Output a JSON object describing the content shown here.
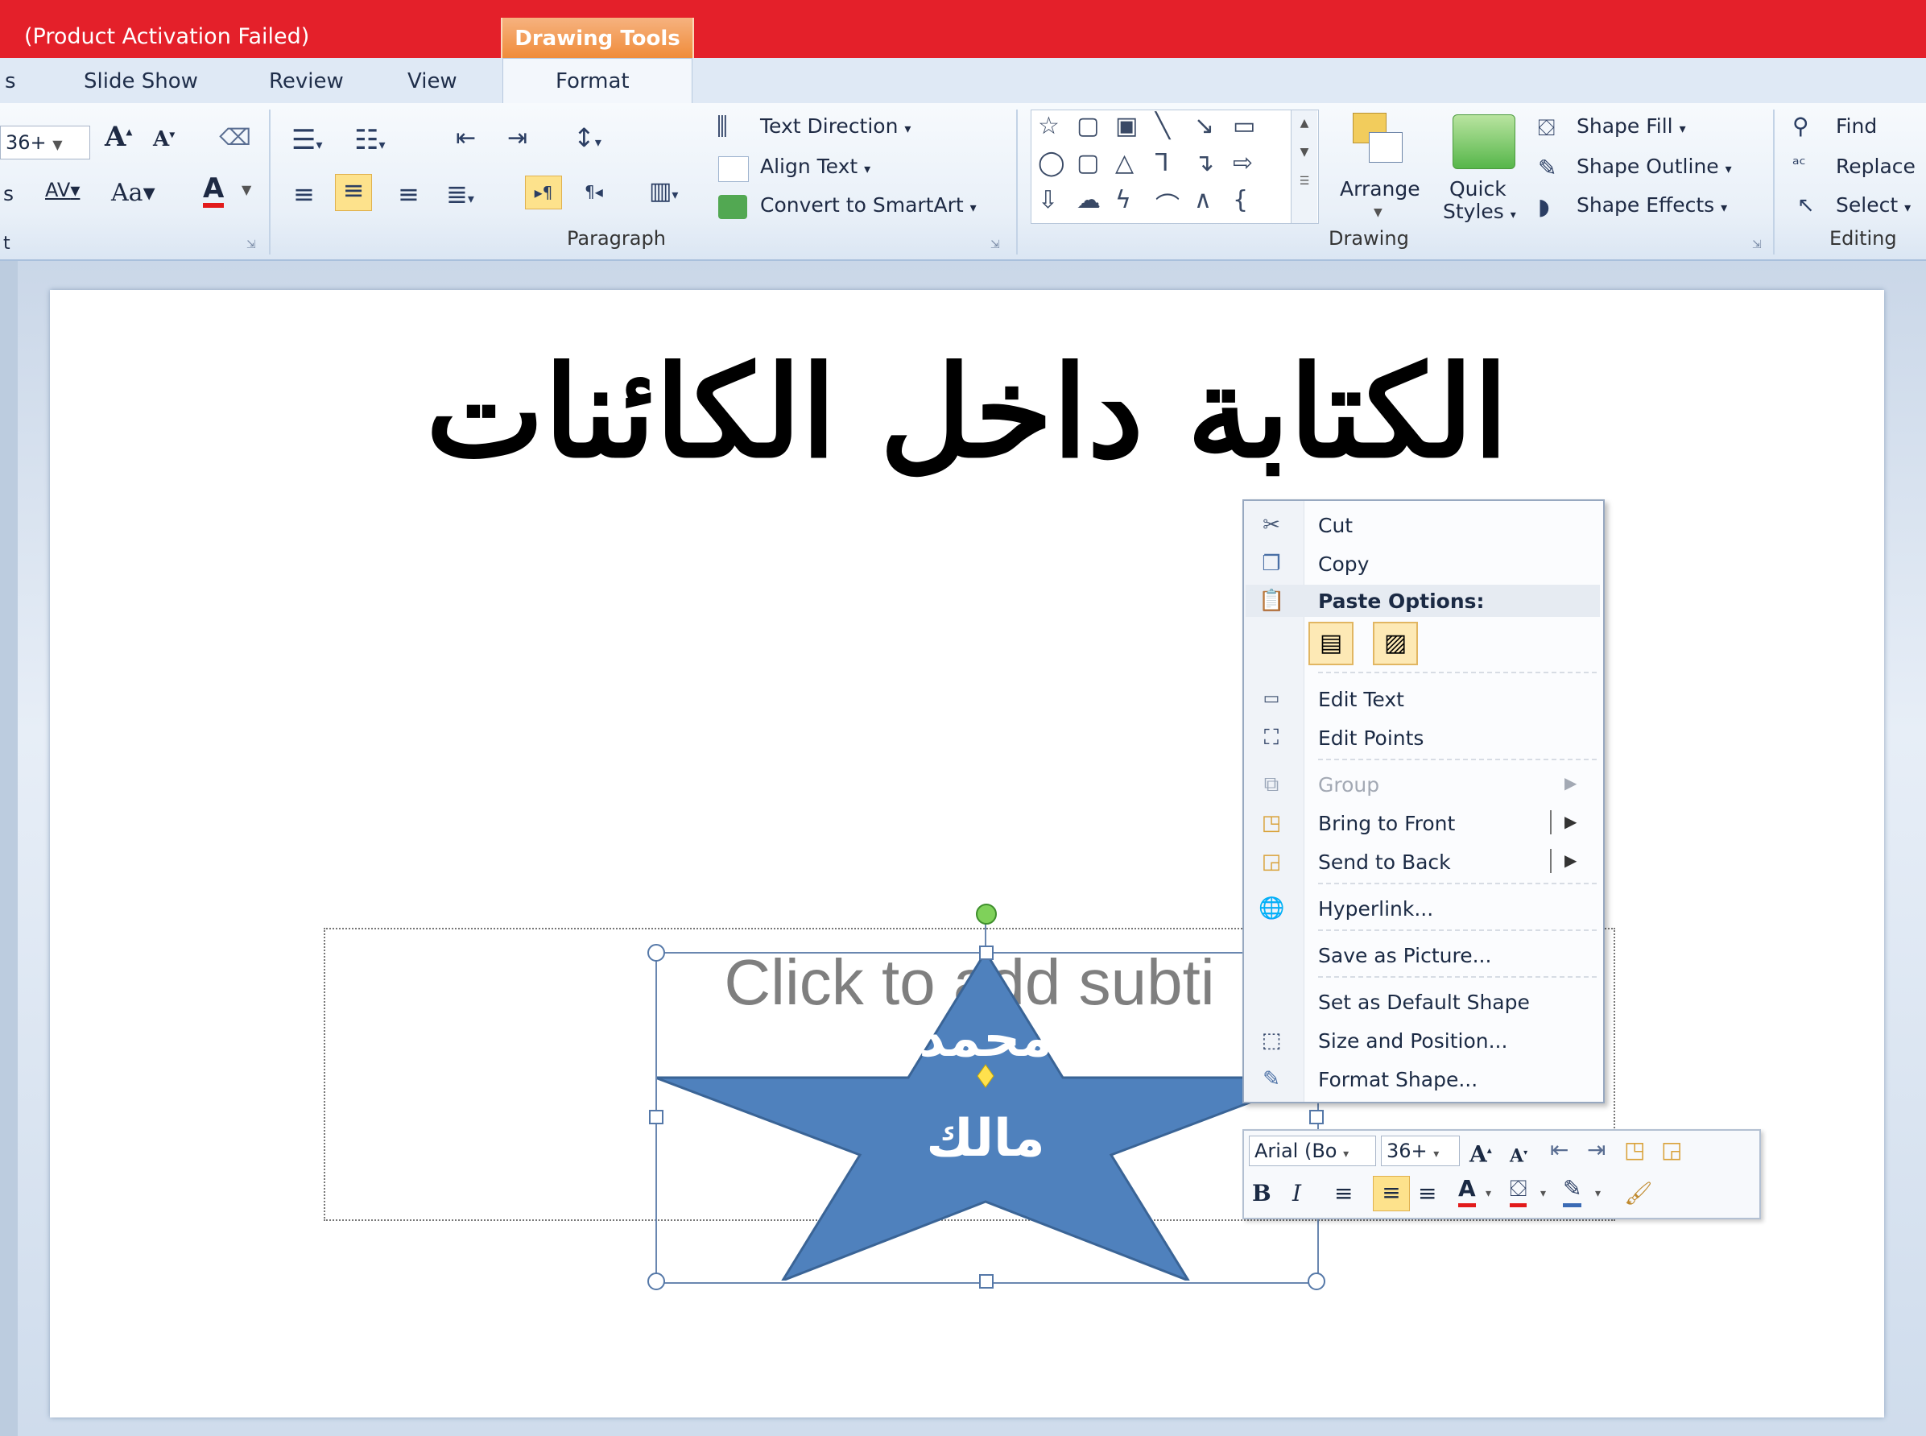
{
  "window": {
    "title": "(Product Activation Failed)",
    "contextual_tab": "Drawing Tools"
  },
  "tabs": {
    "partial_left": "s",
    "slide_show": "Slide Show",
    "review": "Review",
    "view": "View",
    "format": "Format"
  },
  "ribbon": {
    "font_group": {
      "font_size": "36+",
      "grow_font": "A",
      "shrink_font": "A",
      "change_case": "Aa",
      "char_spacing": "AV",
      "font_color": "A",
      "partial_label": "t",
      "partial_left": "s"
    },
    "paragraph_group": {
      "label": "Paragraph",
      "text_direction": "Text Direction",
      "align_text": "Align Text",
      "convert_smartart": "Convert to SmartArt"
    },
    "drawing_group": {
      "label": "Drawing",
      "arrange": "Arrange",
      "quick_styles_line1": "Quick",
      "quick_styles_line2": "Styles",
      "shape_fill": "Shape Fill",
      "shape_outline": "Shape Outline",
      "shape_effects": "Shape Effects"
    },
    "editing_group": {
      "label": "Editing",
      "find": "Find",
      "replace": "Replace",
      "select": "Select"
    }
  },
  "slide": {
    "title": "الكتابة داخل الكائنات",
    "subtitle_placeholder": "Click to add subti",
    "star_line1": "محمد",
    "star_line2": "مالك"
  },
  "context_menu": {
    "cut": "Cut",
    "copy": "Copy",
    "paste_options": "Paste Options:",
    "edit_text": "Edit Text",
    "edit_points": "Edit Points",
    "group": "Group",
    "bring_to_front": "Bring to Front",
    "send_to_back": "Send to Back",
    "hyperlink": "Hyperlink...",
    "save_as_picture": "Save as Picture...",
    "set_default_shape": "Set as Default Shape",
    "size_position": "Size and Position...",
    "format_shape": "Format Shape..."
  },
  "mini_toolbar": {
    "font": "Arial (Bo",
    "size": "36+",
    "bold": "B",
    "italic": "I",
    "font_color": "A"
  },
  "colors": {
    "title_bar": "#e4202a",
    "star_fill": "#4f81bd",
    "contextual_tab": "#f08c3a"
  }
}
